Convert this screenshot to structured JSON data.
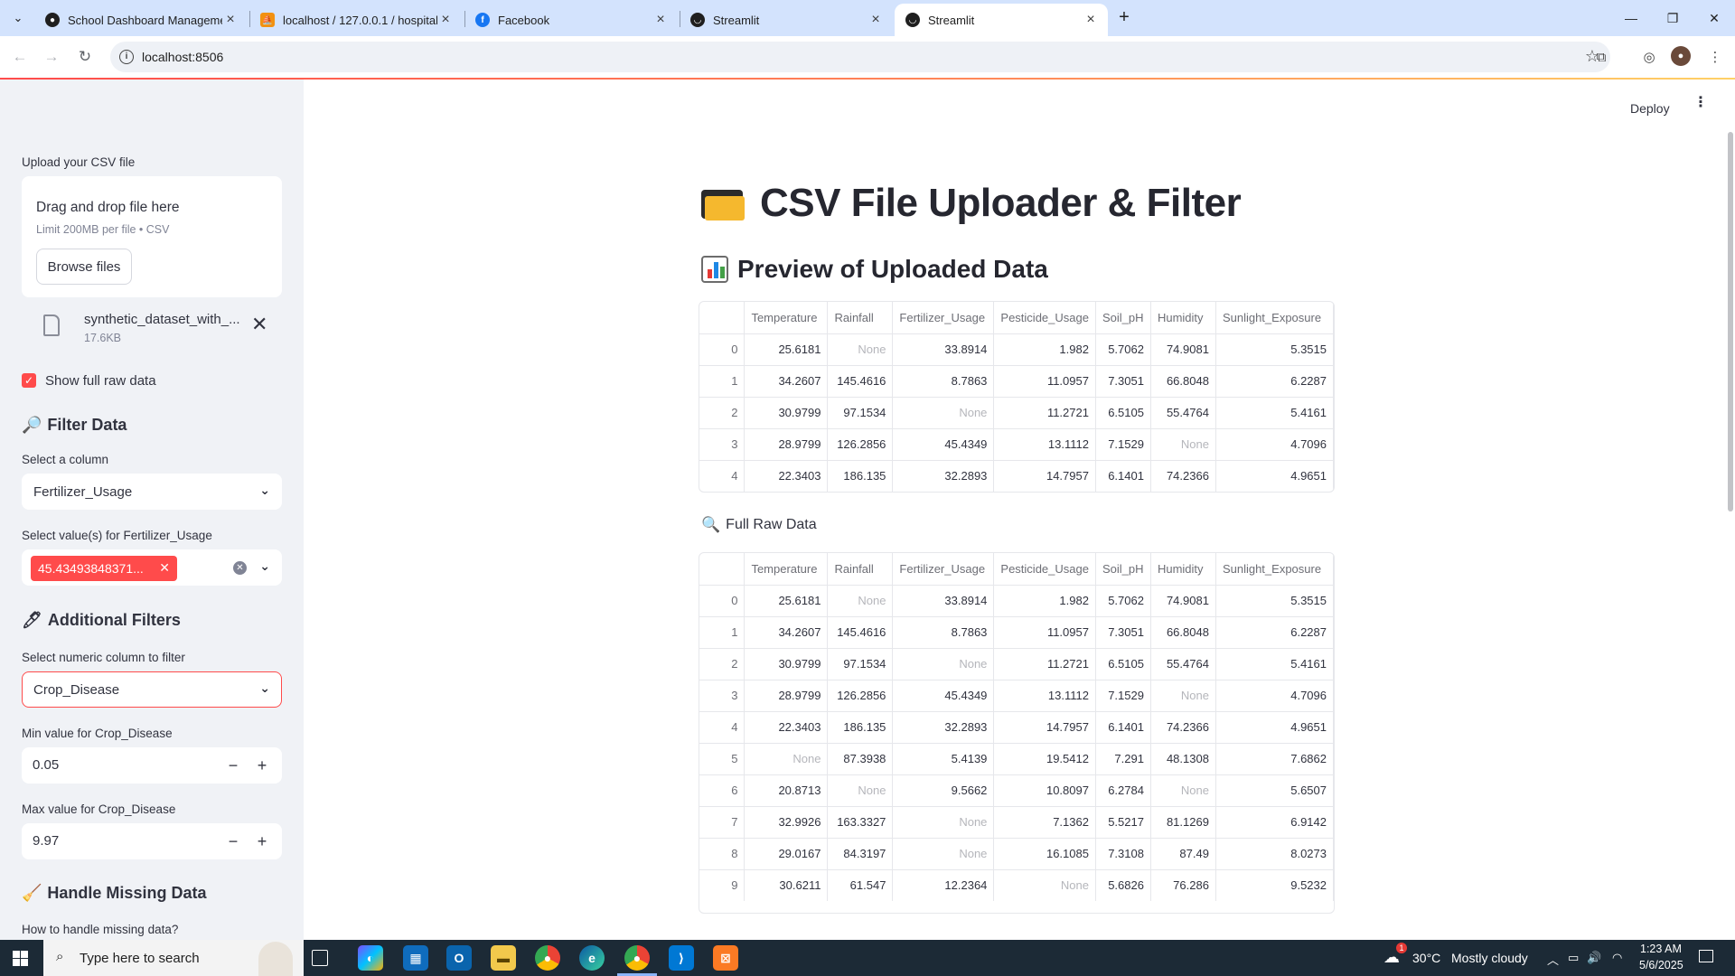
{
  "browser": {
    "tabs": [
      {
        "title": "School Dashboard Managemen",
        "favicon": "github-icon",
        "active": false
      },
      {
        "title": "localhost / 127.0.0.1 / hospital /",
        "favicon": "phpmyadmin-icon",
        "active": false
      },
      {
        "title": "Facebook",
        "favicon": "facebook-icon",
        "active": false
      },
      {
        "title": "Streamlit",
        "favicon": "streamlit-icon",
        "active": false
      },
      {
        "title": "Streamlit",
        "favicon": "streamlit-icon",
        "active": true
      }
    ],
    "url": "localhost:8506"
  },
  "header": {
    "deploy_label": "Deploy"
  },
  "sidebar": {
    "upload_label": "Upload your CSV file",
    "dropzone_title": "Drag and drop file here",
    "dropzone_limit": "Limit 200MB per file • CSV",
    "browse_label": "Browse files",
    "file_name": "synthetic_dataset_with_...",
    "file_size": "17.6KB",
    "show_raw_label": "Show full raw data",
    "show_raw_checked": true,
    "filter_heading": "Filter Data",
    "select_column_label": "Select a column",
    "select_column_value": "Fertilizer_Usage",
    "select_values_label": "Select value(s) for Fertilizer_Usage",
    "selected_chip": "45.43493848371...",
    "additional_heading": "Additional Filters",
    "numeric_column_label": "Select numeric column to filter",
    "numeric_column_value": "Crop_Disease",
    "min_label": "Min value for Crop_Disease",
    "min_value": "0.05",
    "max_label": "Max value for Crop_Disease",
    "max_value": "9.97",
    "missing_heading": "Handle Missing Data",
    "missing_question": "How to handle missing data?"
  },
  "main": {
    "title": "CSV File Uploader & Filter",
    "preview_heading": "Preview of Uploaded Data",
    "raw_heading": "Full Raw Data",
    "columns": [
      "",
      "Temperature",
      "Rainfall",
      "Fertilizer_Usage",
      "Pesticide_Usage",
      "Soil_pH",
      "Humidity",
      "Sunlight_Exposure"
    ],
    "preview_rows": [
      [
        "0",
        "25.6181",
        "None",
        "33.8914",
        "1.982",
        "5.7062",
        "74.9081",
        "5.3515"
      ],
      [
        "1",
        "34.2607",
        "145.4616",
        "8.7863",
        "11.0957",
        "7.3051",
        "66.8048",
        "6.2287"
      ],
      [
        "2",
        "30.9799",
        "97.1534",
        "None",
        "11.2721",
        "6.5105",
        "55.4764",
        "5.4161"
      ],
      [
        "3",
        "28.9799",
        "126.2856",
        "45.4349",
        "13.1112",
        "7.1529",
        "None",
        "4.7096"
      ],
      [
        "4",
        "22.3403",
        "186.135",
        "32.2893",
        "14.7957",
        "6.1401",
        "74.2366",
        "4.9651"
      ]
    ],
    "raw_rows": [
      [
        "0",
        "25.6181",
        "None",
        "33.8914",
        "1.982",
        "5.7062",
        "74.9081",
        "5.3515"
      ],
      [
        "1",
        "34.2607",
        "145.4616",
        "8.7863",
        "11.0957",
        "7.3051",
        "66.8048",
        "6.2287"
      ],
      [
        "2",
        "30.9799",
        "97.1534",
        "None",
        "11.2721",
        "6.5105",
        "55.4764",
        "5.4161"
      ],
      [
        "3",
        "28.9799",
        "126.2856",
        "45.4349",
        "13.1112",
        "7.1529",
        "None",
        "4.7096"
      ],
      [
        "4",
        "22.3403",
        "186.135",
        "32.2893",
        "14.7957",
        "6.1401",
        "74.2366",
        "4.9651"
      ],
      [
        "5",
        "None",
        "87.3938",
        "5.4139",
        "19.5412",
        "7.291",
        "48.1308",
        "7.6862"
      ],
      [
        "6",
        "20.8713",
        "None",
        "9.5662",
        "10.8097",
        "6.2784",
        "None",
        "5.6507"
      ],
      [
        "7",
        "32.9926",
        "163.3327",
        "None",
        "7.1362",
        "5.5217",
        "81.1269",
        "6.9142"
      ],
      [
        "8",
        "29.0167",
        "84.3197",
        "None",
        "16.1085",
        "7.3108",
        "87.49",
        "8.0273"
      ],
      [
        "9",
        "30.6211",
        "61.547",
        "12.2364",
        "None",
        "5.6826",
        "76.286",
        "9.5232"
      ]
    ]
  },
  "taskbar": {
    "search_placeholder": "Type here to search",
    "weather_temp": "30°C",
    "weather_text": "Mostly cloudy",
    "weather_badge": "1",
    "time": "1:23 AM",
    "date": "5/6/2025"
  },
  "colors": {
    "accent": "#ff4b4b",
    "sidebar_bg": "#f0f2f6",
    "tabbar_bg": "#d3e3fd",
    "taskbar_bg": "#1c2a36"
  }
}
